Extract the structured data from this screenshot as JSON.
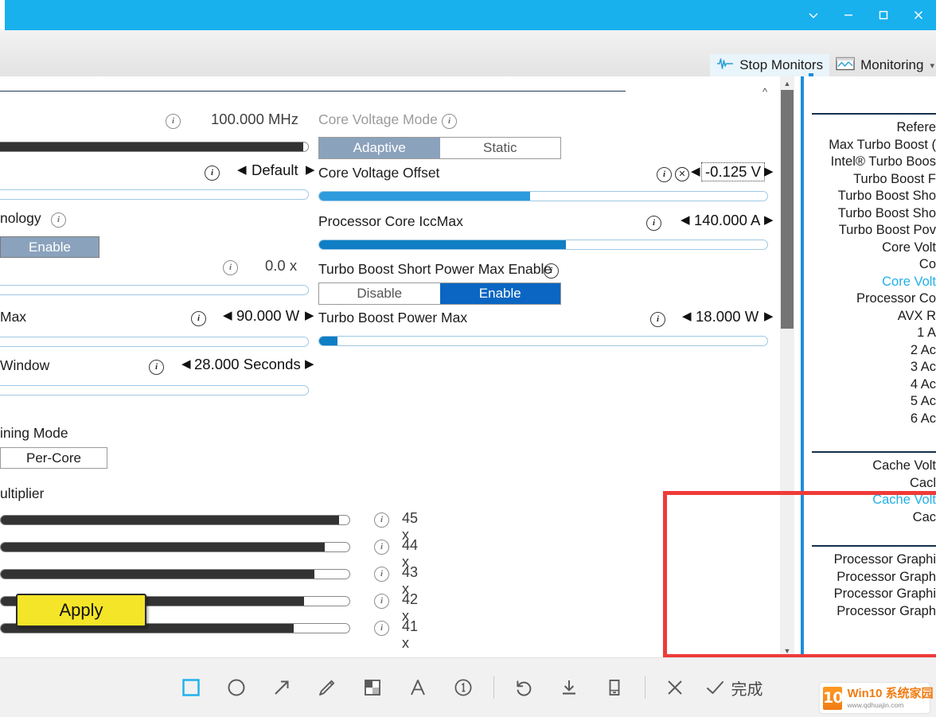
{
  "titlebar": {
    "chevron_down": "chevron-down",
    "minimize": "minimize",
    "maximize": "maximize",
    "close": "close"
  },
  "app_toolbar": {
    "stop_monitors": "Stop Monitors",
    "monitoring": "Monitoring",
    "caret": "▾"
  },
  "left_column": {
    "reference_clock_value": "100.000 MHz",
    "default_label": "Default",
    "technology_label": "nology",
    "enable_button": "Enable",
    "ratio_value": "0.0 x",
    "power_max_label": " Max",
    "power_max_value": "90.000 W",
    "window_label": "Window",
    "window_value": "28.000 Seconds",
    "tuning_mode_label": "ining Mode",
    "per_core_button": "Per-Core",
    "multiplier_label": "ultiplier",
    "multipliers": [
      {
        "value": "45 x",
        "fill": 97
      },
      {
        "value": "44 x",
        "fill": 93
      },
      {
        "value": "43 x",
        "fill": 90
      },
      {
        "value": "42 x",
        "fill": 87
      },
      {
        "value": "41 x",
        "fill": 84
      }
    ]
  },
  "center_column": {
    "core_voltage_mode_label": "Core Voltage Mode",
    "core_voltage_mode_options": [
      "Adaptive",
      "Static"
    ],
    "core_voltage_mode_selected": "Adaptive",
    "core_voltage_offset_label": "Core Voltage Offset",
    "core_voltage_offset_value": "-0.125 V",
    "core_voltage_offset_fill": 47,
    "iccmax_label": "Processor Core IccMax",
    "iccmax_value": "140.000 A",
    "iccmax_fill": 55,
    "tbspm_enable_label": "Turbo Boost Short Power Max Enable",
    "tbspm_options": [
      "Disable",
      "Enable"
    ],
    "tbspm_selected": "Enable",
    "turbo_boost_power_max_label": "Turbo Boost Power Max",
    "turbo_boost_power_max_value": "18.000 W",
    "turbo_boost_power_max_fill": 4
  },
  "right_panel": {
    "group1": [
      {
        "text": "Refere",
        "accent": false
      },
      {
        "text": "Max Turbo Boost (",
        "accent": false
      },
      {
        "text": "Intel® Turbo Boos",
        "accent": false
      },
      {
        "text": "Turbo Boost F",
        "accent": false
      },
      {
        "text": "Turbo Boost Sho",
        "accent": false
      },
      {
        "text": "Turbo Boost Sho",
        "accent": false
      },
      {
        "text": "Turbo Boost Pov",
        "accent": false
      },
      {
        "text": "Core Volt",
        "accent": false
      },
      {
        "text": "Co",
        "accent": false
      },
      {
        "text": "Core Volt",
        "accent": true
      },
      {
        "text": "Processor Co",
        "accent": false
      },
      {
        "text": "AVX R",
        "accent": false
      },
      {
        "text": "1 A",
        "accent": false
      },
      {
        "text": "2 Ac",
        "accent": false
      },
      {
        "text": "3 Ac",
        "accent": false
      },
      {
        "text": "4 Ac",
        "accent": false
      },
      {
        "text": "5 Ac",
        "accent": false
      },
      {
        "text": "6 Ac",
        "accent": false
      }
    ],
    "group2": [
      {
        "text": "Cache Volt",
        "accent": false
      },
      {
        "text": "Cacl",
        "accent": false
      },
      {
        "text": "Cache Volt",
        "accent": true
      },
      {
        "text": "Cac",
        "accent": false
      }
    ],
    "group3": [
      {
        "text": "Processor Graphi",
        "accent": false
      },
      {
        "text": "Processor Graph",
        "accent": false
      },
      {
        "text": "Processor Graphi",
        "accent": false
      },
      {
        "text": "Processor Graph",
        "accent": false
      }
    ],
    "apply_button": "Apply"
  },
  "annotation_toolbar": {
    "tools": [
      {
        "name": "rectangle-tool",
        "selected": true
      },
      {
        "name": "ellipse-tool",
        "selected": false
      },
      {
        "name": "arrow-tool",
        "selected": false
      },
      {
        "name": "pen-tool",
        "selected": false
      },
      {
        "name": "mosaic-tool",
        "selected": false
      },
      {
        "name": "text-tool",
        "selected": false
      },
      {
        "name": "number-tool",
        "selected": false
      }
    ],
    "undo": "undo",
    "download": "download",
    "pin": "pin",
    "cancel": "close",
    "done_label": "完成"
  },
  "watermark": {
    "badge": "10",
    "title": "Win10 系统家园",
    "url": "www.qdhuajin.com"
  },
  "colors": {
    "title_bar": "#19b0ee",
    "accent_blue": "#21b0e6",
    "apply_yellow": "#f5e528",
    "annotation_red": "#ef3b39",
    "slider_blue": "#0f7ec4"
  }
}
